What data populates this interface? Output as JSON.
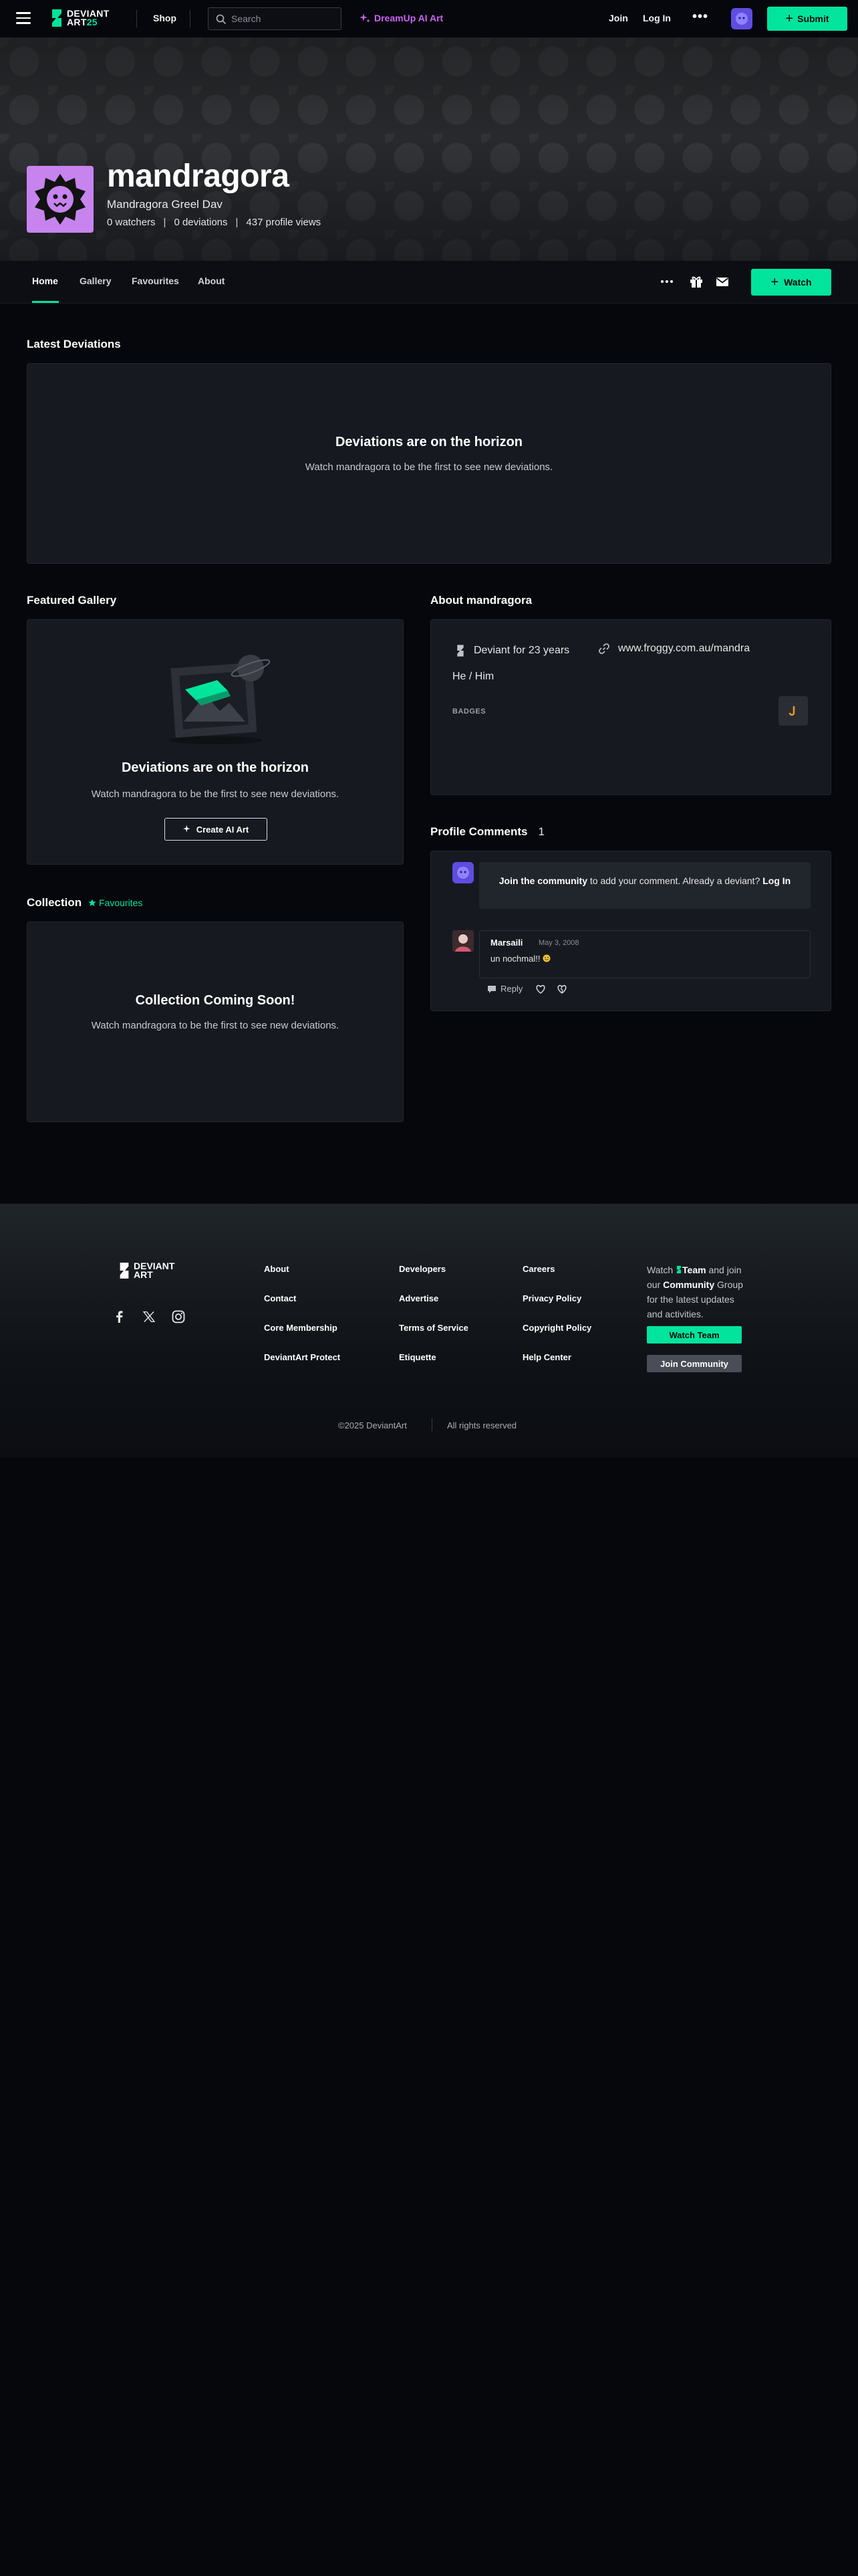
{
  "topbar": {
    "logo_line1": "DEVIANT",
    "logo_line2": "ART",
    "logo_year": "25",
    "shop": "Shop",
    "search_placeholder": "Search",
    "dreamup": "DreamUp AI Art",
    "join": "Join",
    "login": "Log In",
    "more": "•••",
    "submit": "Submit"
  },
  "profile": {
    "username": "mandragora",
    "tagline": "Mandragora Greel Dav",
    "stats": [
      "0 watchers",
      "0 deviations",
      "437 profile views"
    ]
  },
  "tabs": {
    "items": [
      "Home",
      "Gallery",
      "Favourites",
      "About"
    ],
    "watch": "Watch"
  },
  "latest": {
    "title": "Latest Deviations",
    "empty_title": "Deviations are on the horizon",
    "empty_sub": "Watch mandragora to be the first to see new deviations."
  },
  "featured": {
    "title": "Featured Gallery",
    "empty_title": "Deviations are on the horizon",
    "empty_sub": "Watch mandragora to be the first to see new deviations.",
    "button": "Create AI Art"
  },
  "collection": {
    "title": "Collection",
    "link": "Favourites",
    "empty_title": "Collection Coming Soon!",
    "empty_sub": "Watch mandragora to be the first to see new deviations."
  },
  "about": {
    "title": "About mandragora",
    "deviant_for": "Deviant for 23 years",
    "website": "www.froggy.com.au/mandra",
    "pronouns": "He / Him",
    "badges_label": "BADGES"
  },
  "comments": {
    "title": "Profile Comments",
    "count": "1",
    "join_link": "Join the community",
    "join_text": " to add your comment. Already a deviant? ",
    "login_link": "Log In",
    "items": [
      {
        "author": "Marsaili",
        "date": "May 3, 2008",
        "text": "un nochmal!!",
        "reply": "Reply"
      }
    ]
  },
  "footer": {
    "col1": [
      "About",
      "Contact",
      "Core Membership",
      "DeviantArt Protect"
    ],
    "col2": [
      "Developers",
      "Advertise",
      "Terms of Service",
      "Etiquette"
    ],
    "col3": [
      "Careers",
      "Privacy Policy",
      "Copyright Policy",
      "Help Center"
    ],
    "watch_text_1": "Watch ",
    "team": "Team",
    "watch_text_2": " and join our ",
    "community": "Community",
    "watch_text_3": " Group for the latest updates and activities.",
    "watch_team_btn": "Watch Team",
    "join_community_btn": "Join Community",
    "copyright": "©2025 DeviantArt",
    "rights": "All rights reserved"
  },
  "colors": {
    "accent": "#00e59b",
    "dreamup": "#c964f4",
    "avatar_bg": "#c784ef"
  }
}
